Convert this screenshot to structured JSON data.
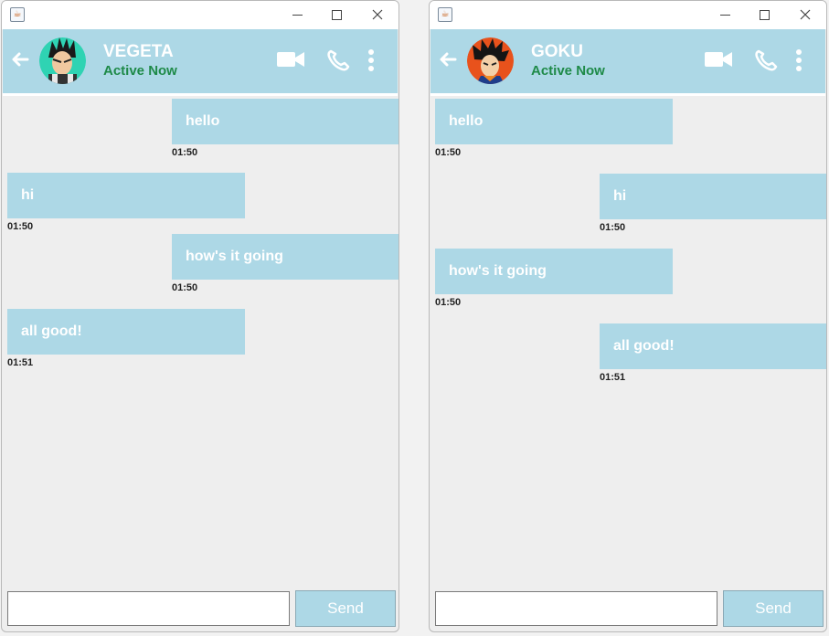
{
  "colors": {
    "header_bg": "#add8e6",
    "bubble_bg": "#add8e6",
    "status_green": "#1e8a48"
  },
  "windows": [
    {
      "window_icon": "java-icon",
      "contact": {
        "name": "VEGETA",
        "status": "Active Now",
        "avatar": "vegeta-avatar"
      },
      "messages": [
        {
          "text": "hello",
          "time": "01:50",
          "side": "right"
        },
        {
          "text": "hi",
          "time": "01:50",
          "side": "left"
        },
        {
          "text": "how's it going",
          "time": "01:50",
          "side": "right"
        },
        {
          "text": "all good!",
          "time": "01:51",
          "side": "left"
        }
      ],
      "composer": {
        "value": "",
        "send_label": "Send"
      }
    },
    {
      "window_icon": "java-icon",
      "contact": {
        "name": "GOKU",
        "status": "Active Now",
        "avatar": "goku-avatar"
      },
      "messages": [
        {
          "text": "hello",
          "time": "01:50",
          "side": "left"
        },
        {
          "text": "hi",
          "time": "01:50",
          "side": "right"
        },
        {
          "text": "how's it going",
          "time": "01:50",
          "side": "left"
        },
        {
          "text": "all good!",
          "time": "01:51",
          "side": "right"
        }
      ],
      "composer": {
        "value": "",
        "send_label": "Send"
      }
    }
  ]
}
